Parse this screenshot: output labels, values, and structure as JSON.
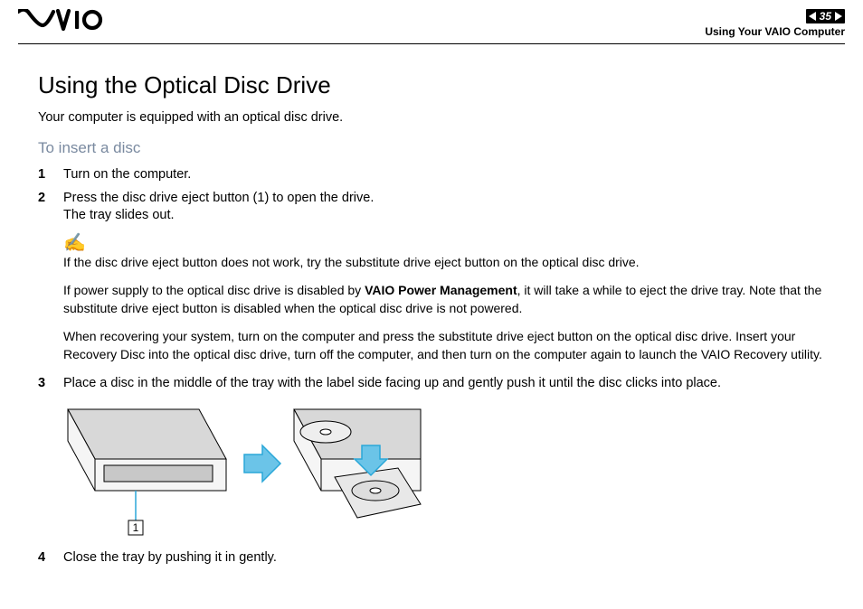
{
  "header": {
    "page_number": "35",
    "breadcrumb": "Using Your VAIO Computer"
  },
  "title": "Using the Optical Disc Drive",
  "intro": "Your computer is equipped with an optical disc drive.",
  "subhead": "To insert a disc",
  "steps": {
    "s1": {
      "num": "1",
      "text": "Turn on the computer."
    },
    "s2": {
      "num": "2",
      "line1": "Press the disc drive eject button (1) to open the drive.",
      "line2": "The tray slides out."
    },
    "s3": {
      "num": "3",
      "text": "Place a disc in the middle of the tray with the label side facing up and gently push it until the disc clicks into place."
    },
    "s4": {
      "num": "4",
      "text": "Close the tray by pushing it in gently."
    }
  },
  "note": {
    "p1": "If the disc drive eject button does not work, try the substitute drive eject button on the optical disc drive.",
    "p2a": "If power supply to the optical disc drive is disabled by ",
    "p2b": "VAIO Power Management",
    "p2c": ", it will take a while to eject the drive tray. Note that the substitute drive eject button is disabled when the optical disc drive is not powered.",
    "p3": "When recovering your system, turn on the computer and press the substitute drive eject button on the optical disc drive. Insert your Recovery Disc into the optical disc drive, turn off the computer, and then turn on the computer again to launch the VAIO Recovery utility."
  },
  "figure": {
    "callout": "1"
  }
}
